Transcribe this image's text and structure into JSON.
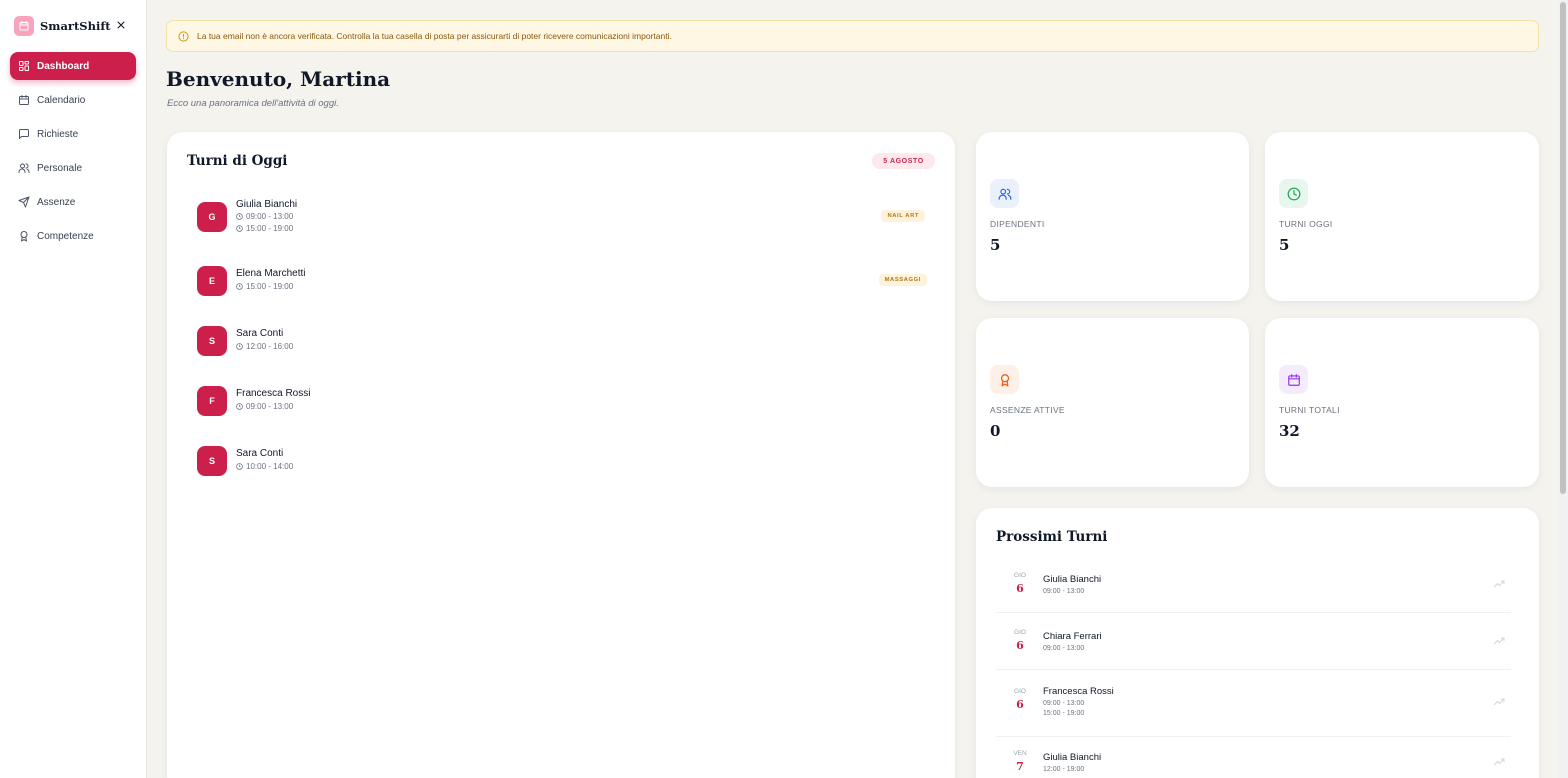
{
  "brand": {
    "name": "SmartShift",
    "logo_icon": "calendar-icon",
    "accent": "#cc1f4c"
  },
  "sidebar": {
    "items": [
      {
        "label": "Dashboard",
        "icon": "dashboard-grid-icon",
        "active": true
      },
      {
        "label": "Calendario",
        "icon": "calendar-icon"
      },
      {
        "label": "Richieste",
        "icon": "message-square-icon"
      },
      {
        "label": "Personale",
        "icon": "users-icon"
      },
      {
        "label": "Assenze",
        "icon": "plane-icon"
      },
      {
        "label": "Competenze",
        "icon": "award-icon"
      }
    ]
  },
  "alert": {
    "text": "La tua email non è ancora verificata. Controlla la tua casella di posta per assicurarti di poter ricevere comunicazioni importanti."
  },
  "header": {
    "title": "Benvenuto, Martina",
    "subtitle": "Ecco una panoramica dell'attività di oggi."
  },
  "today": {
    "title": "Turni di Oggi",
    "date_badge": "5 AGOSTO",
    "shifts": [
      {
        "initial": "G",
        "name": "Giulia Bianchi",
        "times": [
          "09:00 - 13:00",
          "15:00 - 19:00"
        ],
        "tag": "NAIL ART"
      },
      {
        "initial": "E",
        "name": "Elena Marchetti",
        "times": [
          "15:00 - 19:00"
        ],
        "tag": "MASSAGGI"
      },
      {
        "initial": "S",
        "name": "Sara Conti",
        "times": [
          "12:00 - 16:00"
        ]
      },
      {
        "initial": "F",
        "name": "Francesca Rossi",
        "times": [
          "09:00 - 13:00"
        ]
      },
      {
        "initial": "S",
        "name": "Sara Conti",
        "times": [
          "10:00 - 14:00"
        ]
      }
    ]
  },
  "stats": [
    {
      "label": "DIPENDENTI",
      "value": "5",
      "icon": "users-icon",
      "color": "#2563eb",
      "bg": "#eaf1fd"
    },
    {
      "label": "TURNI OGGI",
      "value": "5",
      "icon": "clock-icon",
      "color": "#16a34a",
      "bg": "#e7f7ee"
    },
    {
      "label": "ASSENZE ATTIVE",
      "value": "0",
      "icon": "award-icon",
      "color": "#ea580c",
      "bg": "#fdf0e6"
    },
    {
      "label": "TURNI TOTALI",
      "value": "32",
      "icon": "calendar-icon",
      "color": "#9333ea",
      "bg": "#f4ebfd"
    }
  ],
  "upcoming": {
    "title": "Prossimi Turni",
    "items": [
      {
        "day": "GIO",
        "num": "6",
        "name": "Giulia Bianchi",
        "times": [
          "09:00 - 13:00"
        ]
      },
      {
        "day": "GIO",
        "num": "6",
        "name": "Chiara Ferrari",
        "times": [
          "09:00 - 13:00"
        ]
      },
      {
        "day": "GIO",
        "num": "6",
        "name": "Francesca Rossi",
        "times": [
          "09:00 - 13:00",
          "15:00 - 19:00"
        ]
      },
      {
        "day": "VEN",
        "num": "7",
        "name": "Giulia Bianchi",
        "times": [
          "12:00 - 19:00"
        ]
      }
    ]
  }
}
